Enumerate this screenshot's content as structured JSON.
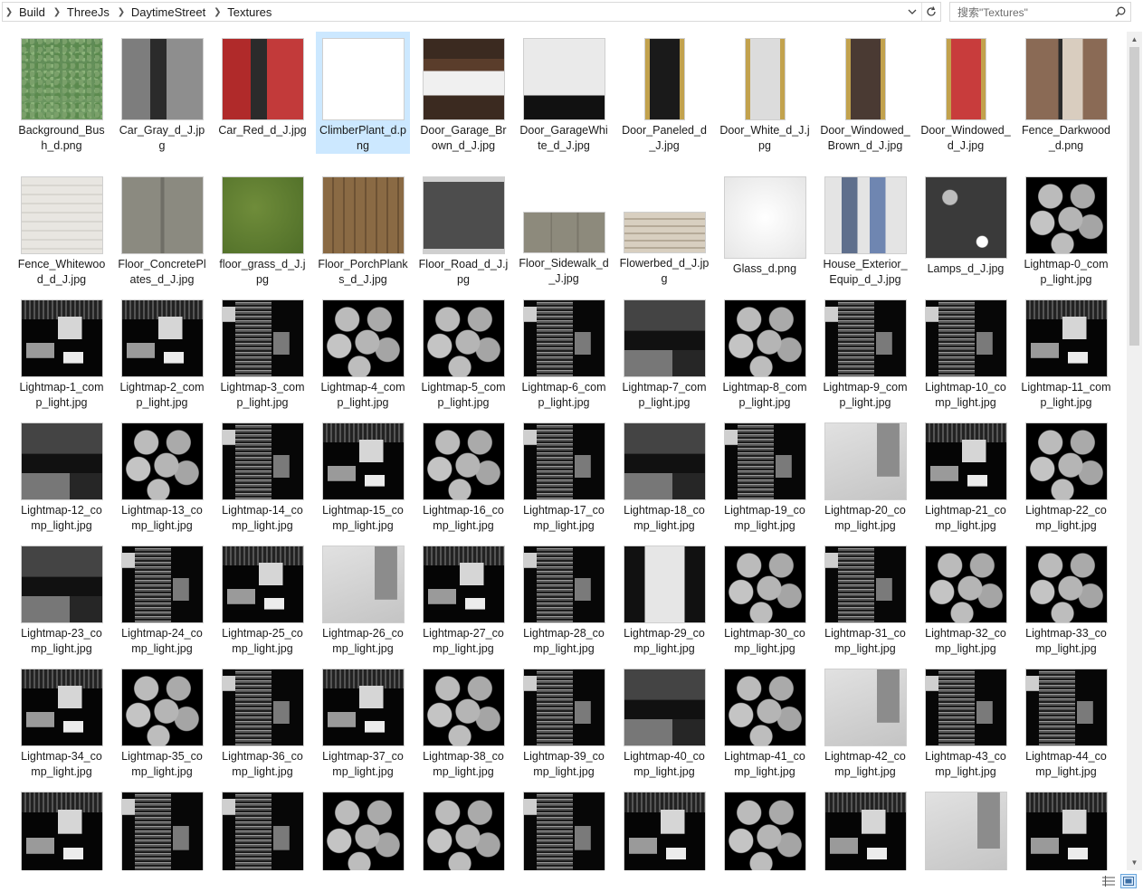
{
  "breadcrumb": {
    "items": [
      "Build",
      "ThreeJs",
      "DaytimeStreet",
      "Textures"
    ]
  },
  "search": {
    "placeholder": "搜索\"Textures\""
  },
  "icons": {
    "chevron": "chevron-right-icon",
    "dropdown": "chevron-down-icon",
    "refresh": "refresh-icon",
    "search": "search-icon"
  },
  "files": [
    {
      "name": "Background_Bush_d.png",
      "thumb": "t-bush"
    },
    {
      "name": "Car_Gray_d_J.jpg",
      "thumb": "t-car-gray"
    },
    {
      "name": "Car_Red_d_J.jpg",
      "thumb": "t-car-red"
    },
    {
      "name": "ClimberPlant_d.png",
      "thumb": "t-plant",
      "selected": true
    },
    {
      "name": "Door_Garage_Brown_d_J.jpg",
      "thumb": "t-garage-b"
    },
    {
      "name": "Door_GarageWhite_d_J.jpg",
      "thumb": "t-garage-w"
    },
    {
      "name": "Door_Paneled_d_J.jpg",
      "thumb": "t-door-panel",
      "door": true
    },
    {
      "name": "Door_White_d_J.jpg",
      "thumb": "t-door-white",
      "door": true
    },
    {
      "name": "Door_Windowed_Brown_d_J.jpg",
      "thumb": "t-door-brown",
      "door": true
    },
    {
      "name": "Door_Windowed_d_J.jpg",
      "thumb": "t-door-red",
      "door": true
    },
    {
      "name": "Fence_Darkwood_d.png",
      "thumb": "t-fence-dark"
    },
    {
      "name": "Fence_Whitewood_d_J.jpg",
      "thumb": "t-fence-white"
    },
    {
      "name": "Floor_ConcretePlates_d_J.jpg",
      "thumb": "t-concrete"
    },
    {
      "name": "floor_grass_d_J.jpg",
      "thumb": "t-grass"
    },
    {
      "name": "Floor_PorchPlanks_d_J.jpg",
      "thumb": "t-porch"
    },
    {
      "name": "Floor_Road_d_J.jpg",
      "thumb": "t-road"
    },
    {
      "name": "Floor_Sidewalk_d_J.jpg",
      "thumb": "t-sidewalk",
      "short": true
    },
    {
      "name": "Flowerbed_d_J.jpg",
      "thumb": "t-flowerbed",
      "short": true
    },
    {
      "name": "Glass_d.png",
      "thumb": "t-glass"
    },
    {
      "name": "House_Exterior_Equip_d_J.jpg",
      "thumb": "t-house"
    },
    {
      "name": "Lamps_d_J.jpg",
      "thumb": "t-lamps"
    },
    {
      "name": "Lightmap-0_comp_light.jpg",
      "thumb": "lm-hex"
    },
    {
      "name": "Lightmap-1_comp_light.jpg",
      "thumb": "lm-block"
    },
    {
      "name": "Lightmap-2_comp_light.jpg",
      "thumb": "lm-block"
    },
    {
      "name": "Lightmap-3_comp_light.jpg",
      "thumb": "lm-stripe"
    },
    {
      "name": "Lightmap-4_comp_light.jpg",
      "thumb": "lm-hex"
    },
    {
      "name": "Lightmap-5_comp_light.jpg",
      "thumb": "lm-hex"
    },
    {
      "name": "Lightmap-6_comp_light.jpg",
      "thumb": "lm-stripe"
    },
    {
      "name": "Lightmap-7_comp_light.jpg",
      "thumb": "lm-gray"
    },
    {
      "name": "Lightmap-8_comp_light.jpg",
      "thumb": "lm-hex"
    },
    {
      "name": "Lightmap-9_comp_light.jpg",
      "thumb": "lm-stripe"
    },
    {
      "name": "Lightmap-10_comp_light.jpg",
      "thumb": "lm-stripe"
    },
    {
      "name": "Lightmap-11_comp_light.jpg",
      "thumb": "lm-block"
    },
    {
      "name": "Lightmap-12_comp_light.jpg",
      "thumb": "lm-gray"
    },
    {
      "name": "Lightmap-13_comp_light.jpg",
      "thumb": "lm-hex"
    },
    {
      "name": "Lightmap-14_comp_light.jpg",
      "thumb": "lm-stripe"
    },
    {
      "name": "Lightmap-15_comp_light.jpg",
      "thumb": "lm-block"
    },
    {
      "name": "Lightmap-16_comp_light.jpg",
      "thumb": "lm-hex"
    },
    {
      "name": "Lightmap-17_comp_light.jpg",
      "thumb": "lm-stripe"
    },
    {
      "name": "Lightmap-18_comp_light.jpg",
      "thumb": "lm-gray"
    },
    {
      "name": "Lightmap-19_comp_light.jpg",
      "thumb": "lm-stripe"
    },
    {
      "name": "Lightmap-20_comp_light.jpg",
      "thumb": "lm-light"
    },
    {
      "name": "Lightmap-21_comp_light.jpg",
      "thumb": "lm-block"
    },
    {
      "name": "Lightmap-22_comp_light.jpg",
      "thumb": "lm-hex"
    },
    {
      "name": "Lightmap-23_comp_light.jpg",
      "thumb": "lm-gray"
    },
    {
      "name": "Lightmap-24_comp_light.jpg",
      "thumb": "lm-stripe"
    },
    {
      "name": "Lightmap-25_comp_light.jpg",
      "thumb": "lm-block"
    },
    {
      "name": "Lightmap-26_comp_light.jpg",
      "thumb": "lm-light"
    },
    {
      "name": "Lightmap-27_comp_light.jpg",
      "thumb": "lm-block"
    },
    {
      "name": "Lightmap-28_comp_light.jpg",
      "thumb": "lm-stripe"
    },
    {
      "name": "Lightmap-29_comp_light.jpg",
      "thumb": "lm-road"
    },
    {
      "name": "Lightmap-30_comp_light.jpg",
      "thumb": "lm-hex"
    },
    {
      "name": "Lightmap-31_comp_light.jpg",
      "thumb": "lm-stripe"
    },
    {
      "name": "Lightmap-32_comp_light.jpg",
      "thumb": "lm-hex"
    },
    {
      "name": "Lightmap-33_comp_light.jpg",
      "thumb": "lm-hex"
    },
    {
      "name": "Lightmap-34_comp_light.jpg",
      "thumb": "lm-block"
    },
    {
      "name": "Lightmap-35_comp_light.jpg",
      "thumb": "lm-hex"
    },
    {
      "name": "Lightmap-36_comp_light.jpg",
      "thumb": "lm-stripe"
    },
    {
      "name": "Lightmap-37_comp_light.jpg",
      "thumb": "lm-block"
    },
    {
      "name": "Lightmap-38_comp_light.jpg",
      "thumb": "lm-hex"
    },
    {
      "name": "Lightmap-39_comp_light.jpg",
      "thumb": "lm-stripe"
    },
    {
      "name": "Lightmap-40_comp_light.jpg",
      "thumb": "lm-gray"
    },
    {
      "name": "Lightmap-41_comp_light.jpg",
      "thumb": "lm-hex"
    },
    {
      "name": "Lightmap-42_comp_light.jpg",
      "thumb": "lm-light"
    },
    {
      "name": "Lightmap-43_comp_light.jpg",
      "thumb": "lm-stripe"
    },
    {
      "name": "Lightmap-44_comp_light.jpg",
      "thumb": "lm-stripe"
    },
    {
      "name": "",
      "thumb": "lm-block"
    },
    {
      "name": "",
      "thumb": "lm-stripe"
    },
    {
      "name": "",
      "thumb": "lm-stripe"
    },
    {
      "name": "",
      "thumb": "lm-hex"
    },
    {
      "name": "",
      "thumb": "lm-hex"
    },
    {
      "name": "",
      "thumb": "lm-stripe"
    },
    {
      "name": "",
      "thumb": "lm-block"
    },
    {
      "name": "",
      "thumb": "lm-hex"
    },
    {
      "name": "",
      "thumb": "lm-block"
    },
    {
      "name": "",
      "thumb": "lm-light"
    },
    {
      "name": "",
      "thumb": "lm-block"
    }
  ],
  "colors": {
    "selection": "#cce8ff",
    "view_active": "#69a7de"
  }
}
